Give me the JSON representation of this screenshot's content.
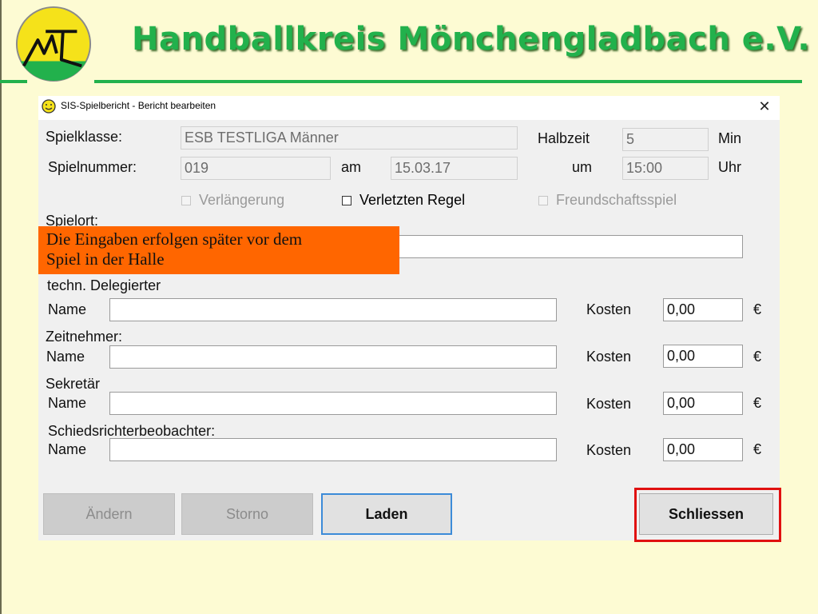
{
  "header": {
    "title": "Handballkreis Mönchengladbach e.V.",
    "colors": {
      "green": "#22b14c",
      "logo_yellow": "#f5e21a"
    }
  },
  "window": {
    "title": "SIS-Spielbericht - Bericht bearbeiten",
    "app_icon": "smiley-icon",
    "close_label": "✕"
  },
  "form": {
    "spielklasse_label": "Spielklasse:",
    "spielklasse_value": "ESB TESTLIGA Männer",
    "halbzeit_label": "Halbzeit",
    "halbzeit_value": "5",
    "min_label": "Min",
    "spielnummer_label": "Spielnummer:",
    "spielnummer_value": "019",
    "am_label": "am",
    "date_value": "15.03.17",
    "um_label": "um",
    "time_value": "15:00",
    "uhr_label": "Uhr",
    "verlaengerung_label": "Verlängerung",
    "verletzten_label": "Verletzten Regel",
    "freundschaft_label": "Freundschaftsspiel",
    "spielort_label": "Spielort:",
    "spielort_value": "",
    "delegierter_label": "techn. Delegierter",
    "zeitnehmer_label": "Zeitnehmer:",
    "sekretaer_label": "Sekretär",
    "beobachter_label": "Schiedsrichterbeobachter:",
    "name_label": "Name",
    "kosten_label": "Kosten",
    "currency": "€",
    "rows": [
      {
        "name": "",
        "kosten": "0,00"
      },
      {
        "name": "",
        "kosten": "0,00"
      },
      {
        "name": "",
        "kosten": "0,00"
      },
      {
        "name": "",
        "kosten": "0,00"
      }
    ]
  },
  "note": {
    "line1": "Die Eingaben erfolgen später vor dem",
    "line2": "Spiel in der Halle"
  },
  "buttons": {
    "aendern": "Ändern",
    "storno": "Storno",
    "laden": "Laden",
    "schliessen": "Schliessen"
  }
}
